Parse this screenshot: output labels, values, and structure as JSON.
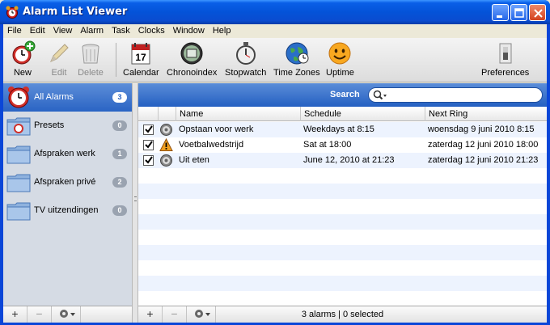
{
  "window": {
    "title": "Alarm List Viewer"
  },
  "menu": [
    "File",
    "Edit",
    "View",
    "Alarm",
    "Task",
    "Clocks",
    "Window",
    "Help"
  ],
  "toolbar": {
    "new": "New",
    "edit": "Edit",
    "delete": "Delete",
    "calendar": "Calendar",
    "calendar_day": "17",
    "chronoindex": "Chronoindex",
    "stopwatch": "Stopwatch",
    "timezones": "Time Zones",
    "uptime": "Uptime",
    "preferences": "Preferences"
  },
  "sidebar": {
    "items": [
      {
        "label": "All Alarms",
        "count": "3"
      },
      {
        "label": "Presets",
        "count": "0"
      },
      {
        "label": "Afspraken werk",
        "count": "1"
      },
      {
        "label": "Afspraken privé",
        "count": "2"
      },
      {
        "label": "TV uitzendingen",
        "count": "0"
      }
    ]
  },
  "search": {
    "label": "Search",
    "placeholder": ""
  },
  "table": {
    "columns": {
      "name": "Name",
      "schedule": "Schedule",
      "next": "Next Ring"
    },
    "rows": [
      {
        "checked": true,
        "icon": "gear-icon",
        "name": "Opstaan voor werk",
        "schedule": "Weekdays at 8:15",
        "next": "woensdag 9 juni 2010 8:15"
      },
      {
        "checked": true,
        "icon": "warning-icon",
        "name": "Voetbalwedstrijd",
        "schedule": "Sat at 18:00",
        "next": "zaterdag 12 juni 2010 18:00"
      },
      {
        "checked": true,
        "icon": "gear-icon",
        "name": "Uit eten",
        "schedule": "June 12, 2010 at 21:23",
        "next": "zaterdag 12 juni 2010 21:23"
      }
    ]
  },
  "bottom": {
    "add": "+",
    "remove": "−",
    "status": "3 alarms | 0 selected"
  },
  "colors": {
    "selection": "#2a64c4",
    "titlebar": "#0a5fe8",
    "row_alt": "#edf3fe"
  }
}
